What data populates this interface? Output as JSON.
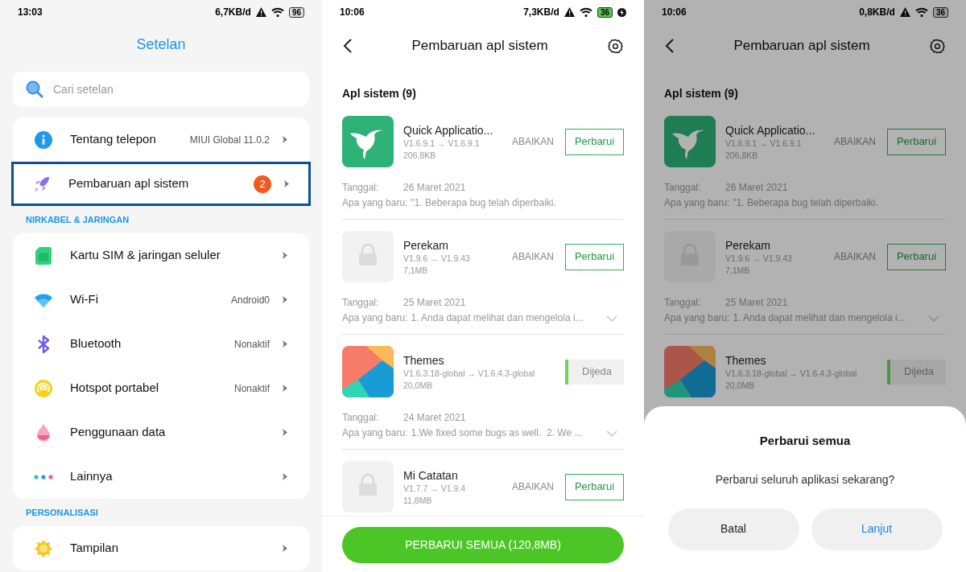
{
  "panels": [
    {
      "kind": "settings",
      "status_bar": {
        "time": "13:03",
        "speed": "6,7KB/d",
        "battery": "96",
        "charging": false
      },
      "title": "Setelan",
      "search": {
        "placeholder": "Cari setelan"
      },
      "groups": [
        {
          "items": [
            {
              "kind": "about",
              "label": "Tentang telepon",
              "value": "MIUI Global 11.0.2",
              "selected": false
            },
            {
              "kind": "updates",
              "label": "Pembaruan apl sistem",
              "badge": "2",
              "selected": true
            }
          ]
        },
        {
          "header": "NIRKABEL & JARINGAN",
          "items": [
            {
              "kind": "sim",
              "label": "Kartu SIM & jaringan seluler",
              "selected": false
            },
            {
              "kind": "wifi",
              "label": "Wi-Fi",
              "value": "Android0",
              "selected": false
            },
            {
              "kind": "bluetooth",
              "label": "Bluetooth",
              "value": "Nonaktif",
              "selected": false
            },
            {
              "kind": "hotspot",
              "label": "Hotspot portabel",
              "value": "Nonaktif",
              "selected": false
            },
            {
              "kind": "data",
              "label": "Penggunaan data",
              "selected": false
            },
            {
              "kind": "more",
              "label": "Lainnya",
              "selected": false
            }
          ]
        },
        {
          "header": "PERSONALISASI",
          "items": [
            {
              "kind": "display",
              "label": "Tampilan",
              "selected": false
            }
          ]
        }
      ]
    },
    {
      "kind": "updates",
      "dimmed": false,
      "status_bar": {
        "time": "10:06",
        "speed": "7,3KB/d",
        "battery": "36",
        "charging": true
      },
      "title": "Pembaruan apl sistem",
      "section": "Apl sistem (9)",
      "apps": [
        {
          "kind": "quick",
          "name": "Quick Applicatio...",
          "version": "V1.6.9.1 → V1.6.9.1",
          "size": "206,8KB",
          "ignore": "ABAIKAN",
          "button": {
            "kind": "update",
            "label": "Perbarui"
          },
          "date_label": "Tanggal:",
          "date": "26 Maret 2021",
          "news_label": "Apa yang baru:",
          "news": "\"1. Beberapa bug telah diperbaiki.",
          "expand_toggle": false
        },
        {
          "kind": "generic",
          "name": "Perekam",
          "version": "V1.9.6 → V1.9.43",
          "size": "7,1MB",
          "ignore": "ABAIKAN",
          "button": {
            "kind": "update",
            "label": "Perbarui"
          },
          "date_label": "Tanggal:",
          "date": "25 Maret 2021",
          "news_label": "Apa yang baru:",
          "news": "1. Anda dapat melihat dan mengelola i...",
          "expand_toggle": true
        },
        {
          "kind": "themes",
          "name": "Themes",
          "version": "V1.6.3.18-global → V1.6.4.3-global",
          "size": "20,0MB",
          "button": {
            "kind": "paused",
            "label": "Dijeda",
            "level": 0.06
          },
          "date_label": "Tanggal:",
          "date": "24 Maret 2021",
          "news_label": "Apa yang baru:",
          "news": "1.We fixed some bugs as well.  2. We ...",
          "expand_toggle": true
        },
        {
          "kind": "generic",
          "name": "Mi Catatan",
          "version": "V1.7.7 → V1.9.4",
          "size": "11,8MB",
          "ignore": "ABAIKAN",
          "button": {
            "kind": "update",
            "label": "Perbarui"
          }
        }
      ],
      "update_all_button": "PERBARUI SEMUA (120,8MB)"
    },
    {
      "kind": "updates",
      "dimmed": true,
      "status_bar": {
        "time": "10:06",
        "speed": "0,8KB/d",
        "battery": "36",
        "charging": false
      },
      "title": "Pembaruan apl sistem",
      "section": "Apl sistem (9)",
      "apps": [
        {
          "kind": "quick",
          "name": "Quick Applicatio...",
          "version": "V1.6.9.1 → V1.6.9.1",
          "size": "206,8KB",
          "ignore": "ABAIKAN",
          "button": {
            "kind": "update",
            "label": "Perbarui"
          },
          "date_label": "Tanggal:",
          "date": "26 Maret 2021",
          "news_label": "Apa yang baru:",
          "news": "\"1. Beberapa bug telah diperbaiki.",
          "expand_toggle": false
        },
        {
          "kind": "generic",
          "name": "Perekam",
          "version": "V1.9.6 → V1.9.43",
          "size": "7,1MB",
          "ignore": "ABAIKAN",
          "button": {
            "kind": "update",
            "label": "Perbarui"
          },
          "date_label": "Tanggal:",
          "date": "25 Maret 2021",
          "news_label": "Apa yang baru:",
          "news": "1. Anda dapat melihat dan mengelola i...",
          "expand_toggle": true
        },
        {
          "kind": "themes",
          "name": "Themes",
          "version": "V1.6.3.18-global → V1.6.4.3-global",
          "size": "20,0MB",
          "button": {
            "kind": "paused",
            "label": "Dijeda",
            "level": 0.06
          }
        }
      ],
      "dialog": {
        "title": "Perbarui semua",
        "message": "Perbarui seluruh aplikasi sekarang?",
        "buttons": [
          {
            "kind": "cancel",
            "label": "Batal"
          },
          {
            "kind": "confirm",
            "label": "Lanjut"
          }
        ]
      }
    }
  ]
}
